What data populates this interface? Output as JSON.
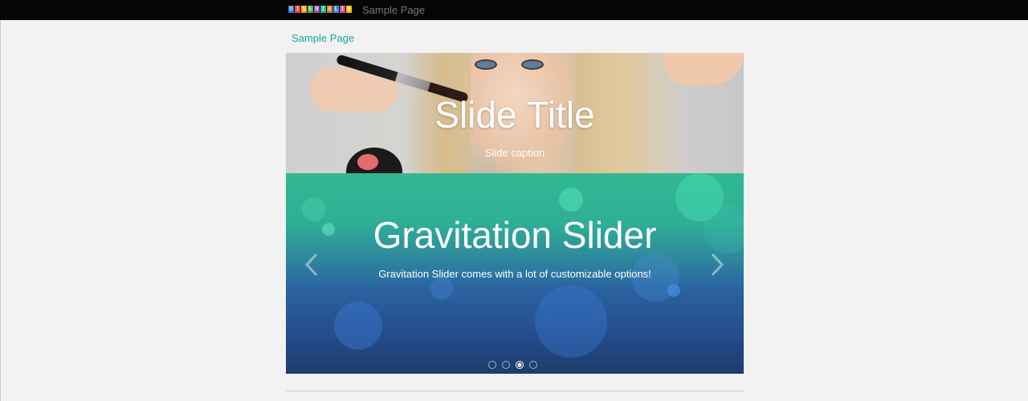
{
  "topbar": {
    "logo_letters": [
      "D",
      "I",
      "S",
      "E",
      "N",
      "I",
      "A",
      "L",
      "I",
      "A"
    ],
    "logo_colors": [
      "#3a7bd5",
      "#e94b3c",
      "#f6a623",
      "#4caf50",
      "#9b59b6",
      "#1abc9c",
      "#e67e22",
      "#3498db",
      "#e84393",
      "#f1c40f"
    ],
    "nav_label": "Sample Page"
  },
  "page": {
    "title": "Sample Page"
  },
  "slider": {
    "slides": [
      {
        "title": "Slide Title",
        "caption": "Slide caption"
      },
      {
        "title": "Gravitation Slider",
        "caption": "Gravitation Slider comes with a lot of customizable options!"
      }
    ],
    "active_index": 2,
    "total_slides": 4,
    "arrows": {
      "left_icon": "chevron-left-icon",
      "right_icon": "chevron-right-icon"
    }
  },
  "colors": {
    "accent": "#17a7a0",
    "topbar": "#050505",
    "background": "#f2f2f2"
  }
}
